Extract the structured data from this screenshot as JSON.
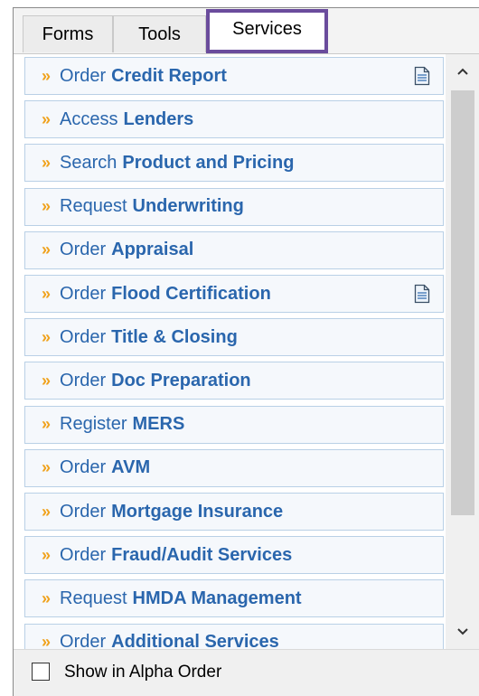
{
  "tabs": [
    {
      "label": "Forms"
    },
    {
      "label": "Tools"
    },
    {
      "label": "Services"
    }
  ],
  "services": [
    {
      "verb": "Order",
      "noun": "Credit Report",
      "has_doc_icon": true
    },
    {
      "verb": "Access",
      "noun": "Lenders",
      "has_doc_icon": false
    },
    {
      "verb": "Search",
      "noun": "Product and Pricing",
      "has_doc_icon": false
    },
    {
      "verb": "Request",
      "noun": "Underwriting",
      "has_doc_icon": false
    },
    {
      "verb": "Order",
      "noun": "Appraisal",
      "has_doc_icon": false
    },
    {
      "verb": "Order",
      "noun": "Flood Certification",
      "has_doc_icon": true
    },
    {
      "verb": "Order",
      "noun": "Title & Closing",
      "has_doc_icon": false
    },
    {
      "verb": "Order",
      "noun": "Doc Preparation",
      "has_doc_icon": false
    },
    {
      "verb": "Register",
      "noun": "MERS",
      "has_doc_icon": false
    },
    {
      "verb": "Order",
      "noun": "AVM",
      "has_doc_icon": false
    },
    {
      "verb": "Order",
      "noun": "Mortgage Insurance",
      "has_doc_icon": false
    },
    {
      "verb": "Order",
      "noun": "Fraud/Audit Services",
      "has_doc_icon": false
    },
    {
      "verb": "Request",
      "noun": "HMDA Management",
      "has_doc_icon": false
    },
    {
      "verb": "Order",
      "noun": "Additional Services",
      "has_doc_icon": false
    }
  ],
  "icons": {
    "item_bullet": "double-chevron-right-icon",
    "doc": "document-icon"
  },
  "colors": {
    "link": "#2a66ad",
    "bullet": "#f0a21c",
    "active_tab_border": "#6a4c9c",
    "item_border": "#b9d0e6"
  },
  "footer": {
    "alpha_order_label": "Show in Alpha Order",
    "alpha_order_checked": false
  }
}
